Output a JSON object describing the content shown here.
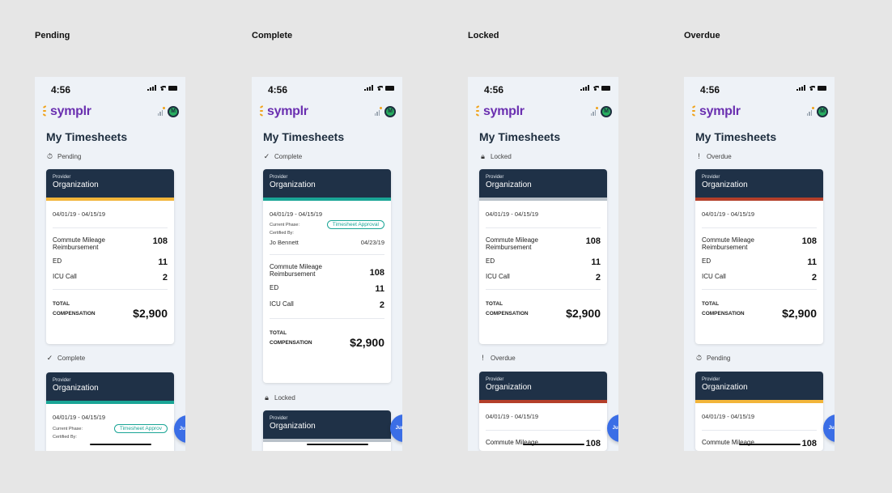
{
  "column_labels": [
    "Pending",
    "Complete",
    "Locked",
    "Overdue"
  ],
  "colors": {
    "pending": "#f2b53a",
    "complete": "#1aa596",
    "locked": "#b8c0c8",
    "overdue": "#b43f2a",
    "card_header": "#1f3147",
    "jump_button": "#3b6ee6"
  },
  "status_time": "4:56",
  "brand": "symplr",
  "avatar_initial": "M",
  "page_title": "My Timesheets",
  "card": {
    "provider": "Provider",
    "organization": "Organization",
    "date_range": "04/01/19 - 04/15/19",
    "items": [
      {
        "label": "Commute Mileage Reimbursement",
        "value": "108"
      },
      {
        "label": "ED",
        "value": "11"
      },
      {
        "label": "ICU Call",
        "value": "2"
      }
    ],
    "total_label_1": "TOTAL",
    "total_label_2": "COMPENSATION",
    "total_value": "$2,900",
    "current_phase_label": "Current Phase:",
    "current_phase_value": "Timesheet Approval",
    "certified_by_label": "Certified By:",
    "certifier": "Jo Bennett",
    "certified_date": "04/23/19",
    "commute_line1": "Commute Mileage",
    "commute_line2": "Reimbursement"
  },
  "sections": {
    "pending": "Pending",
    "complete": "Complete",
    "locked": "Locked",
    "overdue": "Overdue"
  },
  "icons": {
    "pending": "stopwatch-icon",
    "complete": "check-icon",
    "locked": "lock-icon",
    "overdue": "exclamation-icon"
  },
  "jump_label": "Jump ↓",
  "partial_commute": "Commute Mileage",
  "partial_value": "108",
  "partial_pill": "Timesheet Approv"
}
